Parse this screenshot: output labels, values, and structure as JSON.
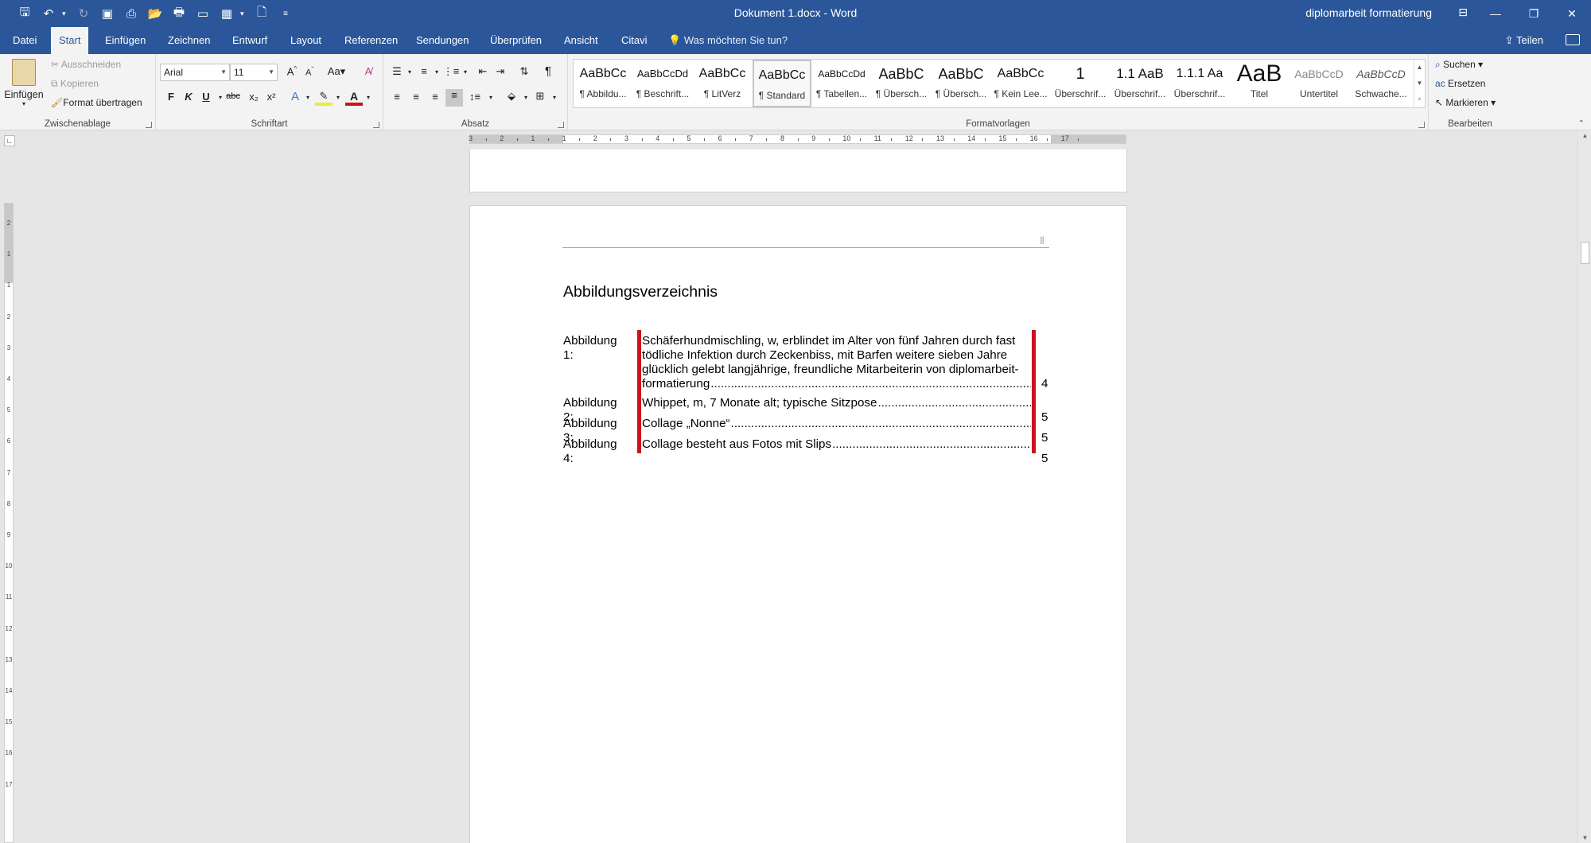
{
  "window": {
    "doc_title": "Dokument 1.docx  -  Word",
    "account": "diplomarbeit formatierung"
  },
  "tabs": [
    "Datei",
    "Start",
    "Einfügen",
    "Zeichnen",
    "Entwurf",
    "Layout",
    "Referenzen",
    "Sendungen",
    "Überprüfen",
    "Ansicht",
    "Citavi"
  ],
  "active_tab": "Start",
  "tell_me": "Was möchten Sie tun?",
  "share_label": "Teilen",
  "clipboard": {
    "paste": "Einfügen",
    "cut": "Ausschneiden",
    "copy": "Kopieren",
    "format_painter": "Format übertragen",
    "label": "Zwischenablage"
  },
  "font": {
    "name": "Arial",
    "size": "11",
    "label": "Schriftart",
    "bold": "F",
    "italic": "K",
    "underline": "U",
    "strike": "abc",
    "sub": "x₂",
    "sup": "x²"
  },
  "paragraph": {
    "label": "Absatz"
  },
  "styles": {
    "label": "Formatvorlagen",
    "items": [
      {
        "preview": "AaBbCc",
        "name": "¶ Abbildu..."
      },
      {
        "preview": "AaBbCcDd",
        "name": "¶ Beschrift..."
      },
      {
        "preview": "AaBbCc",
        "name": "¶ LitVerz"
      },
      {
        "preview": "AaBbCc",
        "name": "¶ Standard"
      },
      {
        "preview": "AaBbCcDd",
        "name": "¶ Tabellen..."
      },
      {
        "preview": "AaBbC",
        "name": "¶ Übersch..."
      },
      {
        "preview": "AaBbC",
        "name": "¶ Übersch..."
      },
      {
        "preview": "AaBbCc",
        "name": "¶ Kein Lee..."
      },
      {
        "preview": "1",
        "name": "Überschrif..."
      },
      {
        "preview": "1.1 AaB",
        "name": "Überschrif..."
      },
      {
        "preview": "1.1.1 Aa",
        "name": "Überschrif..."
      },
      {
        "preview": "AaB",
        "name": "Titel"
      },
      {
        "preview": "AaBbCcD",
        "name": "Untertitel"
      },
      {
        "preview": "AaBbCcD",
        "name": "Schwache..."
      }
    ],
    "selected": 3
  },
  "editing": {
    "find": "Suchen",
    "replace": "Ersetzen",
    "select": "Markieren",
    "label": "Bearbeiten"
  },
  "ruler": {
    "h_numbers": [
      "3",
      "2",
      "1",
      "1",
      "2",
      "3",
      "4",
      "5",
      "6",
      "7",
      "8",
      "9",
      "10",
      "11",
      "12",
      "13",
      "14",
      "15",
      "16",
      "17"
    ],
    "v_numbers": [
      "2",
      "1",
      "1",
      "2",
      "3",
      "4",
      "5",
      "6",
      "7",
      "8",
      "9",
      "10",
      "11",
      "12",
      "13",
      "14",
      "15",
      "16",
      "17"
    ]
  },
  "document": {
    "heading": "Abbildungsverzeichnis",
    "entries": [
      {
        "label": "Abbildung 1:",
        "lines": [
          "Schäferhundmischling, w, erblindet im Alter von fünf Jahren durch fast",
          "tödliche Infektion durch Zeckenbiss, mit Barfen weitere sieben Jahre",
          "glücklich gelebt langjährige, freundliche Mitarbeiterin von diplomarbeit-"
        ],
        "last_line": "formatierung",
        "page": "4"
      },
      {
        "label": "Abbildung 2:",
        "last_line": "Whippet, m, 7 Monate alt; typische Sitzpose",
        "page": "5"
      },
      {
        "label": "Abbildung 3:",
        "last_line": "Collage „Nonne“",
        "page": "5"
      },
      {
        "label": "Abbildung 4:",
        "last_line": "Collage besteht aus Fotos mit Slips",
        "page": "5"
      }
    ]
  }
}
